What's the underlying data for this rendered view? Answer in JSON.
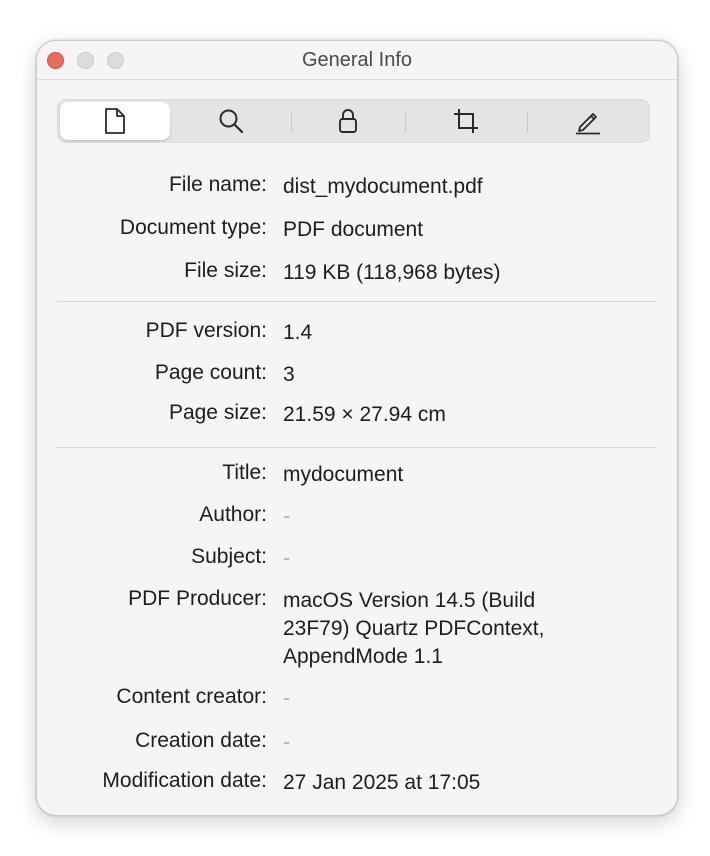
{
  "window": {
    "title": "General Info"
  },
  "toolbar": {
    "tabs": [
      {
        "icon": "document-icon",
        "active": true
      },
      {
        "icon": "magnifier-icon",
        "active": false
      },
      {
        "icon": "lock-icon",
        "active": false
      },
      {
        "icon": "crop-icon",
        "active": false
      },
      {
        "icon": "pencil-icon",
        "active": false
      }
    ]
  },
  "file": {
    "name_label": "File name:",
    "name_value": "dist_mydocument.pdf",
    "type_label": "Document type:",
    "type_value": "PDF document",
    "size_label": "File size:",
    "size_value": "119 KB (118,968 bytes)"
  },
  "pdf": {
    "version_label": "PDF version:",
    "version_value": "1.4",
    "page_count_label": "Page count:",
    "page_count_value": "3",
    "page_size_label": "Page size:",
    "page_size_value": "21.59 × 27.94 cm"
  },
  "meta": {
    "title_label": "Title:",
    "title_value": "mydocument",
    "author_label": "Author:",
    "author_value": "-",
    "subject_label": "Subject:",
    "subject_value": "-",
    "producer_label": "PDF Producer:",
    "producer_value_line1": "macOS Version 14.5 (Build",
    "producer_value_line2": "23F79) Quartz PDFContext,",
    "producer_value_line3": "AppendMode 1.1",
    "creator_label": "Content creator:",
    "creator_value": "-",
    "creation_label": "Creation date:",
    "creation_value": "-",
    "modification_label": "Modification date:",
    "modification_value": "27 Jan 2025 at 17:05"
  },
  "colors": {
    "close": "#ec6a5e",
    "window_bg": "#f5f5f5",
    "muted_text": "#b0b0b0"
  }
}
